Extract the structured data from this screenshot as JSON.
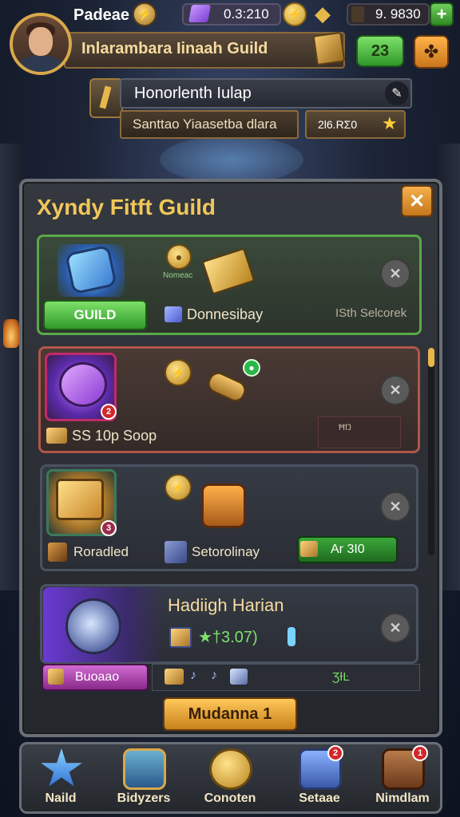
{
  "player": {
    "name": "Padeae",
    "gems": "0.3:210",
    "resource": "9. 9830",
    "plus_label": "+"
  },
  "guild_bar": {
    "title": "Inlarambara Iinaah Guild",
    "count": "23"
  },
  "honor": {
    "title": "Honorlenth Iulap",
    "subtitle": "Santtao Yiaasetba dlara",
    "value": "2Ɩ6.RƩ0"
  },
  "panel": {
    "title": "Xyndy Fitft Guild",
    "close_label": "✕"
  },
  "cards": [
    {
      "mini_label": "Nomeac",
      "button_label": "GUILD",
      "sub_label": "Donnesibay",
      "right_label": "ISth Selcorek",
      "close_label": "✕"
    },
    {
      "badge": "2",
      "footer_label": "SS 10p Soop",
      "box_label": "ĦŊ",
      "close_label": "✕"
    },
    {
      "badge": "3",
      "label_left": "Roradled",
      "label_mid": "Setorolinay",
      "chip_label": "Ar 3I0",
      "close_label": "✕"
    },
    {
      "title": "Hadiigh Harian",
      "stat": "★†3.07)",
      "button_label": "Buoaao",
      "strip_value": "ƷƗĿ",
      "close_label": "✕"
    }
  ],
  "claim_button": "Mudanna 1",
  "nav": [
    {
      "label": "Naild",
      "icon": "star-icon"
    },
    {
      "label": "Bidyzers",
      "icon": "chest-icon",
      "badge": ""
    },
    {
      "label": "Conoten",
      "icon": "coin-icon"
    },
    {
      "label": "Setaae",
      "icon": "helmet-icon",
      "badge": "2"
    },
    {
      "label": "Nimdlam",
      "icon": "box-icon",
      "badge": "1"
    }
  ],
  "colors": {
    "accent_gold": "#f1c75a",
    "green": "#2f9a2a",
    "orange": "#c9761c",
    "panel": "#2c3036"
  }
}
